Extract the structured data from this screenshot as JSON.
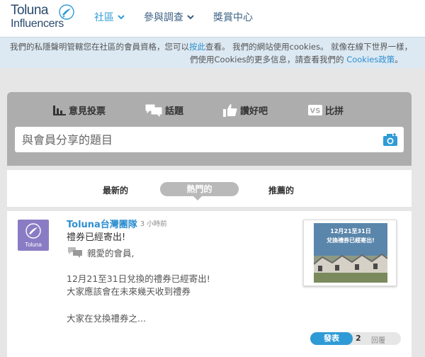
{
  "header": {
    "logo_line1": "Toluna",
    "logo_line2": "Influencers",
    "nav": [
      {
        "label": "社區"
      },
      {
        "label": "參與調查"
      },
      {
        "label": "獎賞中心"
      }
    ]
  },
  "cookie_bar": {
    "line1_a": "我們的私隱聲明管轄您在社區的會員資格，您可以",
    "line1_link": "按此",
    "line1_b": "查看。 我們的網站使用cookies。 就像在線下世界一樣，",
    "line2_a": "們使用Cookies的更多信息，請查看我們的 ",
    "line2_link": "Cookies政策",
    "line2_b": "。"
  },
  "share": {
    "tabs": [
      {
        "label": "意見投票",
        "icon": "bar-chart-icon"
      },
      {
        "label": "話題",
        "icon": "chat-bubbles-icon"
      },
      {
        "label": "讚好吧",
        "icon": "thumbs-up-icon"
      },
      {
        "label": "比拼",
        "icon": "versus-icon"
      }
    ],
    "placeholder": "與會員分享的題目",
    "camera_icon": "camera-icon"
  },
  "sort": {
    "options": [
      "最新的",
      "熱門的",
      "推薦的"
    ],
    "active": "熱門的"
  },
  "post": {
    "author": "Toluna台灣團隊",
    "time": "3 小時前",
    "avatar_label": "Toluna",
    "title": "禮券已經寄出!",
    "greeting": "親愛的會員,",
    "body_line1": "12月21至31日兌換的禮券已經寄出!",
    "body_line2": "大家應該會在未來幾天收到禮券",
    "body_line3": "大家在兌換禮券之...",
    "thumb_line1": "12月21至31日",
    "thumb_line2": "兌換禮券已經寄出!",
    "reply_label": "發表",
    "reply_count": "2",
    "replies_word": "回覆"
  },
  "colors": {
    "accent": "#2f9bd6",
    "logo_text": "#2b4a6e",
    "cookie_bg": "#dce9f3",
    "share_bg": "#adadad",
    "avatar_bg": "#8a7cc4"
  }
}
